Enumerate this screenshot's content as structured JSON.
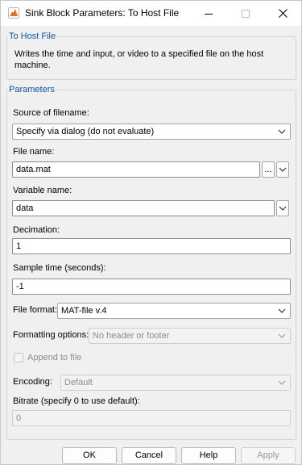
{
  "window": {
    "title": "Sink Block Parameters: To Host File",
    "icon": "simulink-block-icon",
    "controls": [
      "minimize-icon",
      "maximize-icon",
      "close-icon"
    ]
  },
  "description_group": {
    "legend": "To Host File",
    "text": "Writes the time and input, or video to a specified file on the host machine."
  },
  "parameters": {
    "legend": "Parameters",
    "source_of_filename": {
      "label": "Source of filename:",
      "value": "Specify via dialog (do not evaluate)"
    },
    "file_name": {
      "label": "File name:",
      "value": "data.mat",
      "browse_label": "..."
    },
    "variable_name": {
      "label": "Variable name:",
      "value": "data"
    },
    "decimation": {
      "label": "Decimation:",
      "value": "1"
    },
    "sample_time": {
      "label": "Sample time (seconds):",
      "value": "-1"
    },
    "file_format": {
      "label": "File format:",
      "value": "MAT-file v.4"
    },
    "formatting_options": {
      "label": "Formatting options:",
      "value": "No header or footer",
      "enabled": false
    },
    "append_to_file": {
      "label": "Append to file",
      "checked": false,
      "enabled": false
    },
    "encoding": {
      "label": "Encoding:",
      "value": "Default",
      "enabled": false
    },
    "bitrate": {
      "label": "Bitrate (specify 0 to use default):",
      "value": "0",
      "enabled": false
    }
  },
  "buttons": {
    "ok": "OK",
    "cancel": "Cancel",
    "help": "Help",
    "apply": "Apply"
  },
  "colors": {
    "legend_text": "#1452a6",
    "window_bg": "#f0f0f0",
    "disabled_text": "#8c8c8c"
  }
}
